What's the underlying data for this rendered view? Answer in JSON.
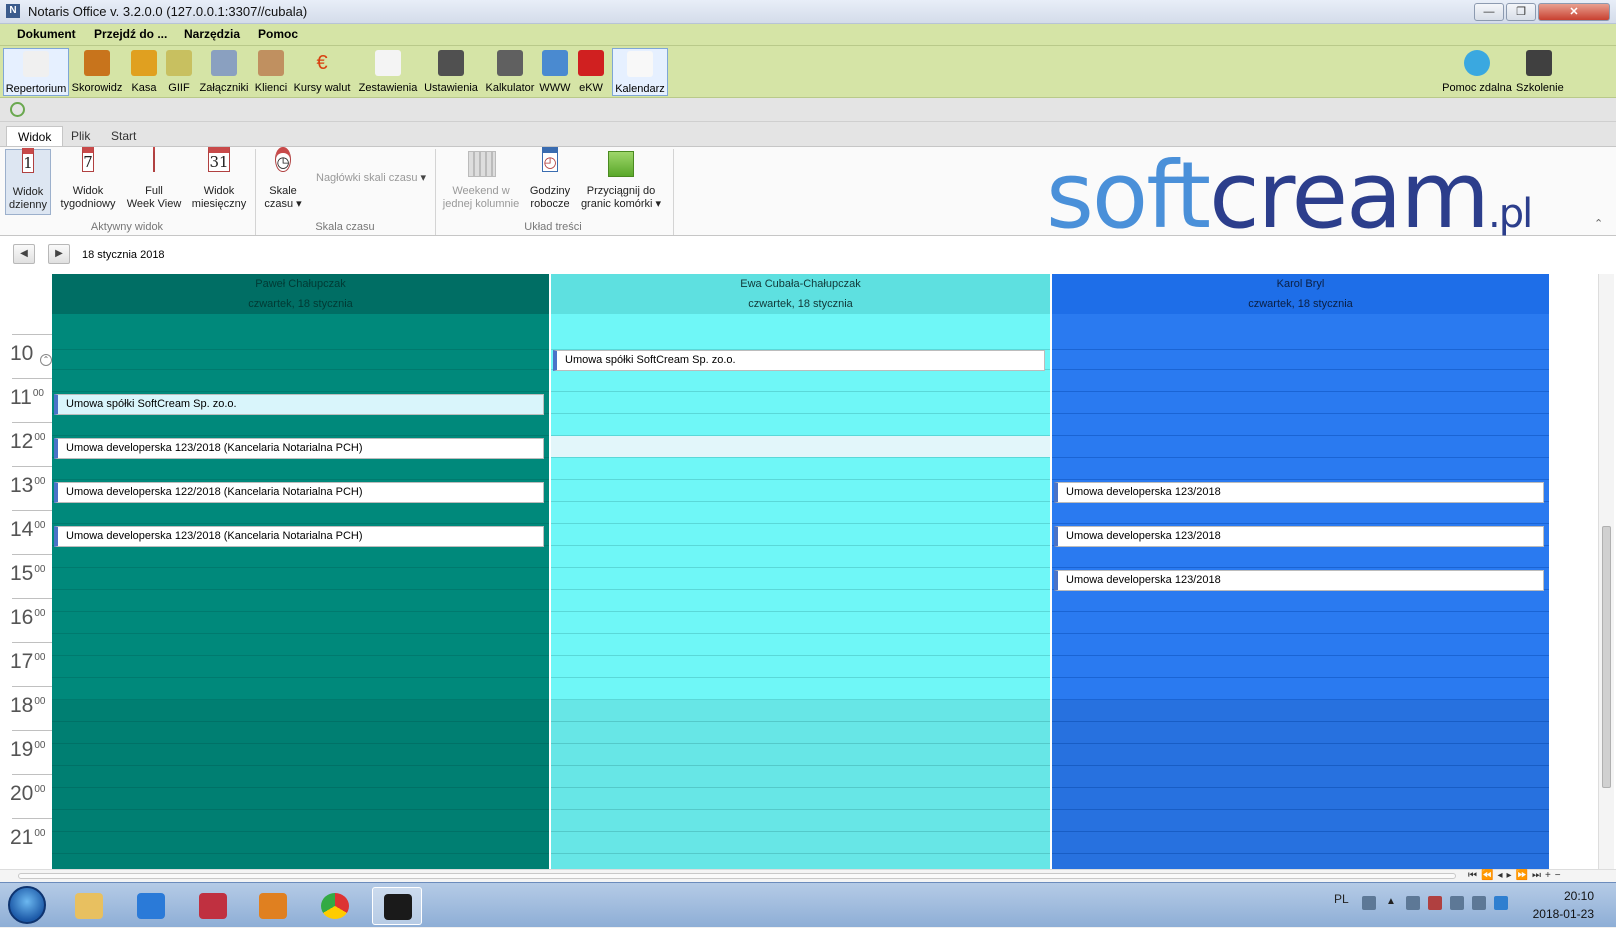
{
  "window": {
    "title": "Notaris Office v. 3.2.0.0 (127.0.0.1:3307//cubala)",
    "minimize": "—",
    "restore": "❐",
    "close": "✕"
  },
  "menu": [
    "Dokument",
    "Przejdź do ...",
    "Narzędzia",
    "Pomoc"
  ],
  "toolbar": {
    "items": [
      {
        "label": "Repertorium",
        "icon": "notebook-pen-icon"
      },
      {
        "label": "Skorowidz",
        "icon": "book-icon"
      },
      {
        "label": "Kasa",
        "icon": "coins-icon"
      },
      {
        "label": "GIIF",
        "icon": "folder-icon"
      },
      {
        "label": "Załączniki",
        "icon": "attachment-icon"
      },
      {
        "label": "Klienci",
        "icon": "people-icon"
      },
      {
        "label": "Kursy walut",
        "icon": "euro-icon"
      },
      {
        "label": "Zestawienia",
        "icon": "report-icon"
      },
      {
        "label": "Ustawienia",
        "icon": "tools-icon"
      },
      {
        "label": "Kalkulator",
        "icon": "calculator-icon"
      },
      {
        "label": "WWW",
        "icon": "globe-icon"
      },
      {
        "label": "eKW",
        "icon": "ekw-icon"
      },
      {
        "label": "Kalendarz",
        "icon": "calendar-clock-icon"
      }
    ],
    "right": [
      {
        "label": "Pomoc zdalna",
        "icon": "lifebuoy-icon"
      },
      {
        "label": "Szkolenie",
        "icon": "clapperboard-icon"
      }
    ]
  },
  "ribbon_tabs": [
    "Widok",
    "Plik",
    "Start"
  ],
  "ribbon": {
    "view_buttons": [
      {
        "line1": "Widok",
        "line2": "dzienny",
        "glyph": "1"
      },
      {
        "line1": "Widok",
        "line2": "tygodniowy",
        "glyph": "7"
      },
      {
        "line1": "Full",
        "line2": "Week View",
        "glyph": ""
      },
      {
        "line1": "Widok",
        "line2": "miesięczny",
        "glyph": "31"
      }
    ],
    "group_active_view": "Aktywny widok",
    "scale_button": {
      "line1": "Skale",
      "line2": "czasu"
    },
    "scale_headers": "Nagłówki skali czasu",
    "group_time_scale": "Skala czasu",
    "weekend": {
      "line1": "Weekend w",
      "line2": "jednej kolumnie"
    },
    "work_hours": {
      "line1": "Godziny",
      "line2": "robocze"
    },
    "snap": {
      "line1": "Przyciągnij do",
      "line2": "granic komórki"
    },
    "group_layout": "Układ treści",
    "logo_main": "soft",
    "logo_accent": "cream",
    "logo_suffix": ".pl"
  },
  "date_nav": {
    "prev": "◀",
    "next": "▶",
    "date": "18 stycznia 2018"
  },
  "hours": [
    {
      "h": "10",
      "m": ""
    },
    {
      "h": "11",
      "m": "00"
    },
    {
      "h": "12",
      "m": "00"
    },
    {
      "h": "13",
      "m": "00"
    },
    {
      "h": "14",
      "m": "00"
    },
    {
      "h": "15",
      "m": "00"
    },
    {
      "h": "16",
      "m": "00"
    },
    {
      "h": "17",
      "m": "00"
    },
    {
      "h": "18",
      "m": "00"
    },
    {
      "h": "19",
      "m": "00"
    },
    {
      "h": "20",
      "m": "00"
    },
    {
      "h": "21",
      "m": "00"
    }
  ],
  "columns": [
    {
      "name": "Paweł Chałupczak",
      "day": "czwartek, 18 stycznia",
      "colors": {
        "head": "#006e64",
        "body": "#00897b",
        "line": "#007a6e",
        "text": "#003a34"
      },
      "appointments": [
        {
          "title": "Umowa spółki SoftCream Sp. zo.o.",
          "slot": 2,
          "highlight": true
        },
        {
          "title": "Umowa developerska 123/2018 (Kancelaria Notarialna PCH)",
          "slot": 4,
          "highlight": false
        },
        {
          "title": "Umowa developerska 122/2018 (Kancelaria Notarialna PCH)",
          "slot": 6,
          "highlight": false
        },
        {
          "title": "Umowa developerska 123/2018 (Kancelaria Notarialna PCH)",
          "slot": 8,
          "highlight": false
        }
      ]
    },
    {
      "name": "Ewa Cubała-Chałupczak",
      "day": "czwartek, 18 stycznia",
      "colors": {
        "head": "#5ee0e0",
        "body": "#6ff7f7",
        "line": "#5ad8d8",
        "text": "#103838"
      },
      "appointments": [
        {
          "title": "Umowa spółki SoftCream Sp. zo.o.",
          "slot": 0,
          "highlight": false
        }
      ]
    },
    {
      "name": "Karol Bryl",
      "day": "czwartek, 18 stycznia",
      "colors": {
        "head": "#1e6ee8",
        "body": "#2a7af0",
        "line": "#1a64d4",
        "text": "#0a1f44"
      },
      "appointments": [
        {
          "title": "Umowa developerska 123/2018",
          "slot": 6,
          "highlight": false
        },
        {
          "title": "Umowa developerska 123/2018",
          "slot": 8,
          "highlight": false
        },
        {
          "title": "Umowa developerska 123/2018",
          "slot": 10,
          "highlight": false
        }
      ]
    }
  ],
  "taskbar": {
    "apps": [
      "explorer-icon",
      "internet-explorer-icon",
      "save-app-icon",
      "media-player-icon",
      "chrome-icon",
      "notaris-icon"
    ],
    "lang": "PL",
    "time": "20:10",
    "date": "2018-01-23"
  }
}
